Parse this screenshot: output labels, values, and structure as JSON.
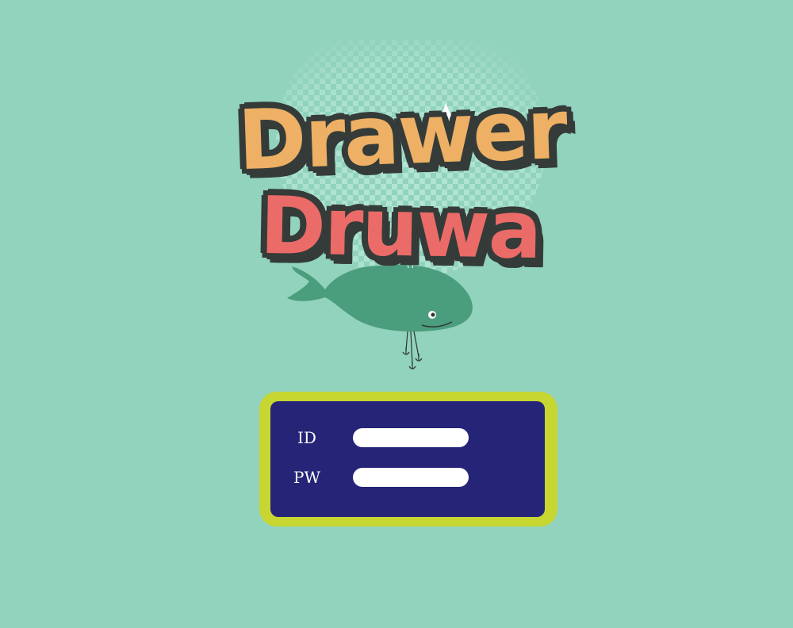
{
  "logo": {
    "line1": "Drawer",
    "line2": "Druwa"
  },
  "login": {
    "id_label": "ID",
    "pw_label": "PW",
    "id_value": "",
    "pw_value": ""
  },
  "colors": {
    "background": "#91d3bd",
    "logo_line1": "#edb064",
    "logo_line2": "#ea6b67",
    "logo_outline": "#343b39",
    "whale": "#4b9e7d",
    "frame": "#c8d631",
    "panel": "#252477",
    "input": "#ffffff"
  }
}
